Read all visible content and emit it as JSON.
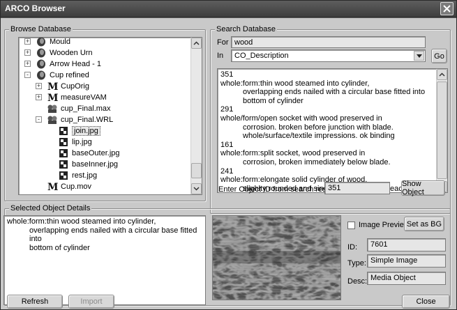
{
  "window": {
    "title": "ARCO Browser"
  },
  "browse": {
    "legend": "Browse Database",
    "tree": [
      {
        "label": "Mould",
        "icon": "disc-icon",
        "expander": "+"
      },
      {
        "label": "Wooden Urn",
        "icon": "disc-icon",
        "expander": "+"
      },
      {
        "label": "Arrow Head - 1",
        "icon": "disc-icon",
        "expander": "+"
      },
      {
        "label": "Cup refined",
        "icon": "disc-icon",
        "expander": "-"
      },
      {
        "label": "CupOrig",
        "icon": "m-icon",
        "expander": "+"
      },
      {
        "label": "measureVAM",
        "icon": "m-icon",
        "expander": "+"
      },
      {
        "label": "cup_Final.max",
        "icon": "object-icon",
        "expander": ""
      },
      {
        "label": "cup_Final.WRL",
        "icon": "object-icon",
        "expander": "-"
      },
      {
        "label": "join.jpg",
        "icon": "image-icon",
        "expander": ""
      },
      {
        "label": "lip.jpg",
        "icon": "image-icon",
        "expander": ""
      },
      {
        "label": "baseOuter.jpg",
        "icon": "image-icon",
        "expander": ""
      },
      {
        "label": "baseInner.jpg",
        "icon": "image-icon",
        "expander": ""
      },
      {
        "label": "rest.jpg",
        "icon": "image-icon",
        "expander": ""
      },
      {
        "label": "Cup.mov",
        "icon": "m-icon",
        "expander": ""
      }
    ]
  },
  "search": {
    "legend": "Search Database",
    "for_label": "For",
    "for_value": "wood",
    "in_label": "In",
    "in_value": "CO_Description",
    "go_label": "Go",
    "results": [
      {
        "text": "351",
        "indent": false
      },
      {
        "text": "whole:form:thin wood steamed into cylinder,",
        "indent": false
      },
      {
        "text": "overlapping ends nailed with a circular base fitted into",
        "indent": true
      },
      {
        "text": "bottom of cylinder",
        "indent": true
      },
      {
        "text": "291",
        "indent": false
      },
      {
        "text": "whole/form/open socket with wood preserved in",
        "indent": false
      },
      {
        "text": "corrosion. broken before junction with blade.",
        "indent": true
      },
      {
        "text": "whole/surface/textile impressions. ok binding",
        "indent": true
      },
      {
        "text": "161",
        "indent": false
      },
      {
        "text": "whole:form:split socket, wood preserved in",
        "indent": false
      },
      {
        "text": "corrosion, broken immediately below blade.",
        "indent": true
      },
      {
        "text": "241",
        "indent": false
      },
      {
        "text": "whole:form:elongate solid cylinder of wood.",
        "indent": false
      },
      {
        "text": "slighlty rounded and single groove close to each end",
        "indent": true
      }
    ],
    "object_id_label": "Enter Object ID from search results",
    "object_id_value": "351",
    "show_object_label": "Show Object"
  },
  "details": {
    "legend": "Selected Object Details",
    "lines": [
      {
        "text": "whole:form:thin wood steamed into cylinder,",
        "indent": false
      },
      {
        "text": "overlapping ends nailed with a circular base fitted into",
        "indent": true
      },
      {
        "text": "bottom of cylinder",
        "indent": true
      }
    ],
    "image_preview_label": "Image Preview",
    "image_preview_checked": false,
    "set_as_bg_label": "Set as BG",
    "id_label": "ID:",
    "id_value": "7601",
    "type_label": "Type:",
    "type_value": "Simple Image",
    "desc_label": "Desc:",
    "desc_value": "Media Object"
  },
  "footer": {
    "refresh_label": "Refresh",
    "import_label": "Import",
    "close_label": "Close"
  }
}
